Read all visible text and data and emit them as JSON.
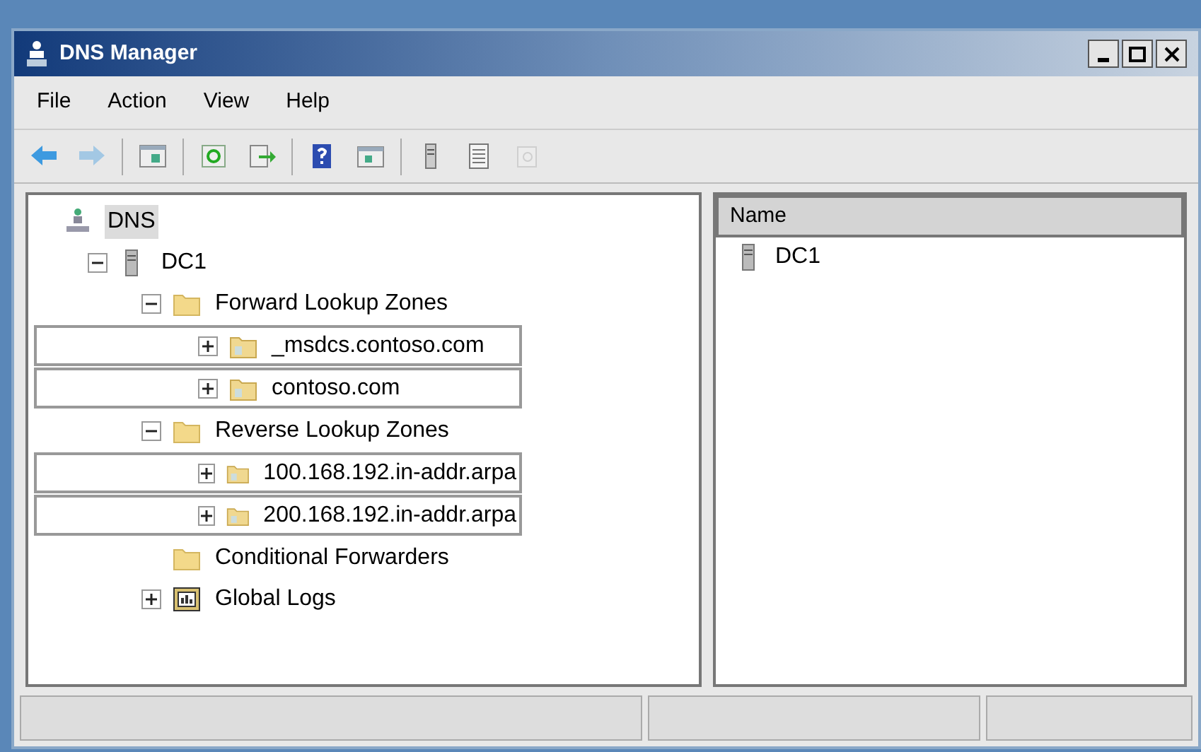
{
  "window": {
    "title": "DNS Manager"
  },
  "menu": [
    "File",
    "Action",
    "View",
    "Help"
  ],
  "toolbar": [
    {
      "kind": "back",
      "disabled": false
    },
    {
      "kind": "forward",
      "disabled": true
    },
    {
      "kind": "sep"
    },
    {
      "kind": "tree",
      "disabled": false
    },
    {
      "kind": "sep"
    },
    {
      "kind": "refresh",
      "disabled": false
    },
    {
      "kind": "export",
      "disabled": false
    },
    {
      "kind": "sep"
    },
    {
      "kind": "help",
      "disabled": false
    },
    {
      "kind": "pane",
      "disabled": false
    },
    {
      "kind": "sep"
    },
    {
      "kind": "server",
      "disabled": false
    },
    {
      "kind": "list",
      "disabled": false
    },
    {
      "kind": "props",
      "disabled": true
    }
  ],
  "tree": [
    {
      "label": "DNS",
      "kind": "root",
      "expandable": false,
      "selected": true,
      "children": [
        {
          "label": "DC1",
          "kind": "server",
          "expandable": true,
          "expanded": true,
          "selected": false,
          "children": [
            {
              "label": "Forward Lookup Zones",
              "kind": "folder",
              "expandable": true,
              "expanded": true,
              "selected": false,
              "children": [
                {
                  "label": "_msdcs.contoso.com",
                  "kind": "zone",
                  "expandable": true,
                  "expanded": false,
                  "selected": false
                },
                {
                  "label": "contoso.com",
                  "kind": "zone",
                  "expandable": true,
                  "expanded": false,
                  "selected": false
                }
              ]
            },
            {
              "label": "Reverse Lookup Zones",
              "kind": "folder",
              "expandable": true,
              "expanded": true,
              "selected": false,
              "children": [
                {
                  "label": "100.168.192.in-addr.arpa",
                  "kind": "zone",
                  "expandable": true,
                  "expanded": false,
                  "selected": false
                },
                {
                  "label": "200.168.192.in-addr.arpa",
                  "kind": "zone",
                  "expandable": true,
                  "expanded": false,
                  "selected": false
                }
              ]
            },
            {
              "label": "Conditional Forwarders",
              "kind": "folder",
              "expandable": false,
              "selected": false
            },
            {
              "label": "Global Logs",
              "kind": "logs",
              "expandable": true,
              "expanded": false,
              "selected": false
            }
          ]
        }
      ]
    }
  ],
  "list": {
    "columns": [
      "Name"
    ],
    "rows": [
      {
        "name": "DC1",
        "kind": "server"
      }
    ]
  }
}
